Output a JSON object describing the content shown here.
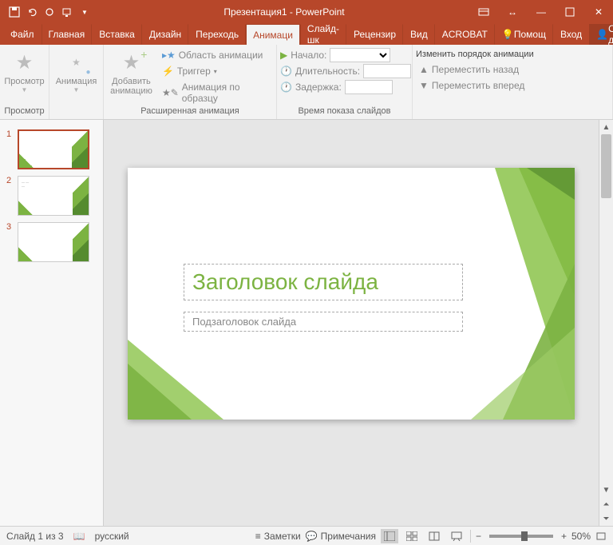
{
  "title": "Презентация1 - PowerPoint",
  "tabs": {
    "file": "Файл",
    "home": "Главная",
    "insert": "Вставка",
    "design": "Дизайн",
    "transitions": "Переходь",
    "animations": "Анимаци",
    "slideshow": "Слайд-шк",
    "review": "Рецензир",
    "view": "Вид",
    "acrobat": "ACROBAT",
    "help": "Помощ",
    "signin": "Вход",
    "share": "Общий доступ"
  },
  "ribbon": {
    "preview": {
      "label": "Просмотр",
      "group": "Просмотр"
    },
    "animation": {
      "label": "Анимация"
    },
    "add_animation": {
      "label": "Добавить\nанимацию"
    },
    "animation_pane": "Область анимации",
    "trigger": "Триггер",
    "animation_painter": "Анимация по образцу",
    "advanced_group": "Расширенная анимация",
    "start": "Начало:",
    "duration": "Длительность:",
    "delay": "Задержка:",
    "timing_group": "Время показа слайдов",
    "reorder_title": "Изменить порядок анимации",
    "move_earlier": "Переместить назад",
    "move_later": "Переместить вперед"
  },
  "slide": {
    "title": "Заголовок слайда",
    "subtitle": "Подзаголовок слайда"
  },
  "status": {
    "slide_count": "Слайд 1 из 3",
    "language": "русский",
    "notes": "Заметки",
    "comments": "Примечания",
    "zoom": "50%"
  },
  "thumbs": [
    "1",
    "2",
    "3"
  ]
}
